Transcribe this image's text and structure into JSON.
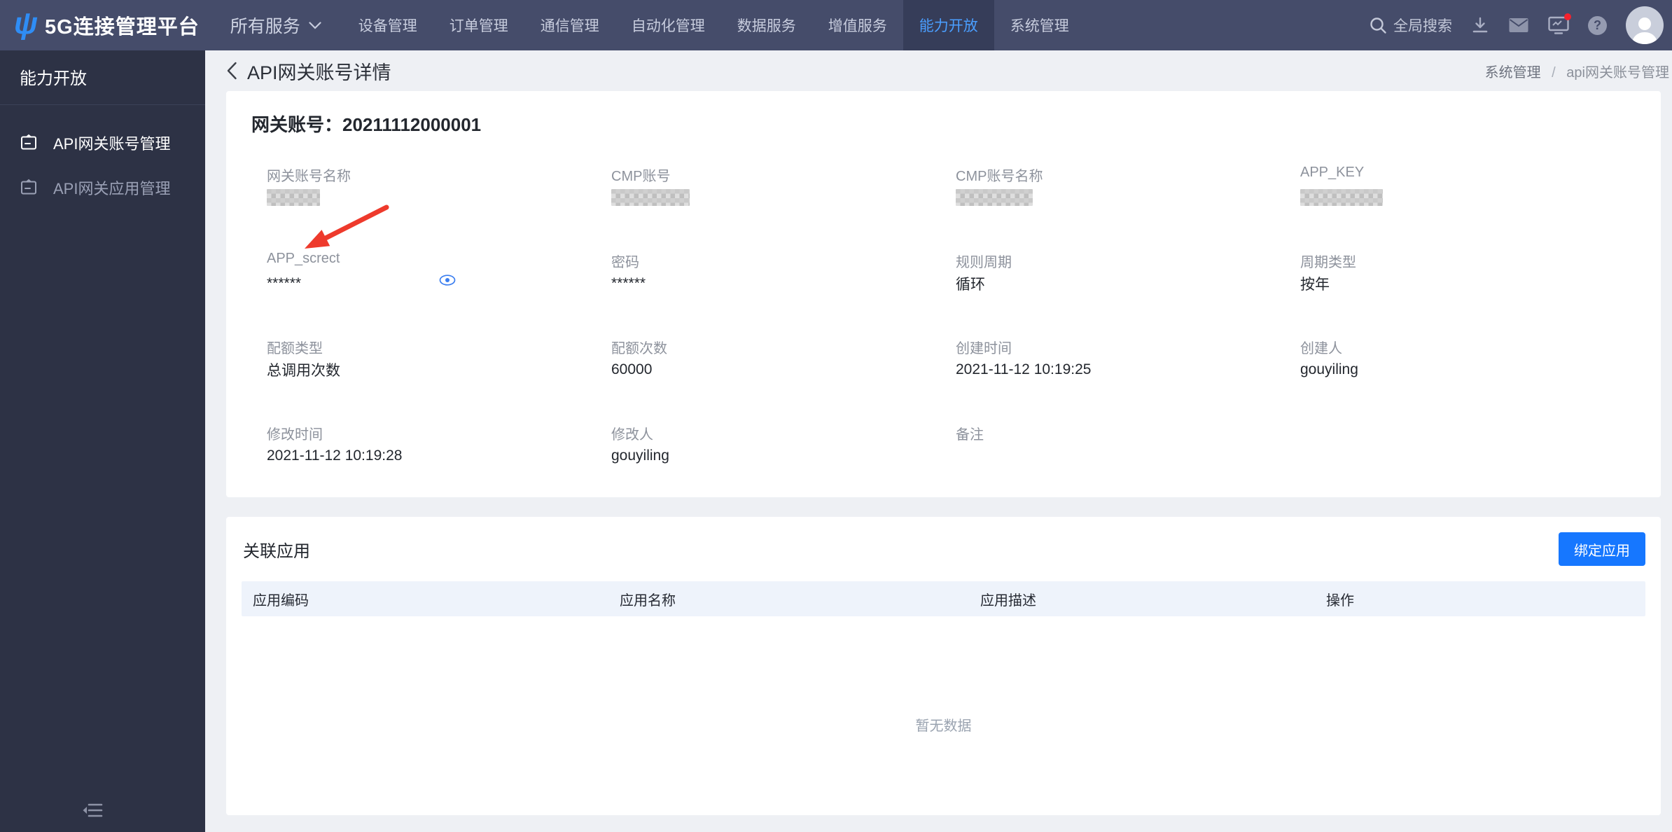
{
  "topbar": {
    "logo_glyph": "ψ",
    "brand": "5G连接管理平台",
    "all_services": "所有服务",
    "nav_items": [
      {
        "label": "设备管理",
        "active": false
      },
      {
        "label": "订单管理",
        "active": false
      },
      {
        "label": "通信管理",
        "active": false
      },
      {
        "label": "自动化管理",
        "active": false
      },
      {
        "label": "数据服务",
        "active": false
      },
      {
        "label": "增值服务",
        "active": false
      },
      {
        "label": "能力开放",
        "active": true
      },
      {
        "label": "系统管理",
        "active": false
      }
    ],
    "search_label": "全局搜索",
    "help_glyph": "?",
    "icons": [
      "search-icon",
      "download-icon",
      "mail-icon",
      "monitor-alert-icon",
      "help-icon",
      "avatar"
    ]
  },
  "sidebar": {
    "title": "能力开放",
    "items": [
      {
        "label": "API网关账号管理",
        "active": true
      },
      {
        "label": "API网关应用管理",
        "active": false
      }
    ]
  },
  "header": {
    "title": "API网关账号详情",
    "breadcrumb_parent": "系统管理",
    "breadcrumb_separator": "/",
    "breadcrumb_current": "api网关账号管理"
  },
  "detail_card": {
    "title": "网关账号：20211112000001",
    "fields": [
      {
        "label": "网关账号名称",
        "value": "",
        "masked": true,
        "mask_w": 76
      },
      {
        "label": "CMP账号",
        "value": "",
        "masked": true,
        "mask_w": 112
      },
      {
        "label": "CMP账号名称",
        "value": "",
        "masked": true,
        "mask_w": 110
      },
      {
        "label": "APP_KEY",
        "value": "",
        "masked": true,
        "mask_w": 118
      },
      {
        "label": "APP_screct",
        "value": "******",
        "has_eye": true
      },
      {
        "label": "密码",
        "value": "******"
      },
      {
        "label": "规则周期",
        "value": "循环"
      },
      {
        "label": "周期类型",
        "value": "按年"
      },
      {
        "label": "配额类型",
        "value": "总调用次数"
      },
      {
        "label": "配额次数",
        "value": "60000"
      },
      {
        "label": "创建时间",
        "value": "2021-11-12 10:19:25"
      },
      {
        "label": "创建人",
        "value": "gouyiling"
      },
      {
        "label": "修改时间",
        "value": "2021-11-12 10:19:28"
      },
      {
        "label": "修改人",
        "value": "gouyiling"
      },
      {
        "label": "备注",
        "value": ""
      }
    ]
  },
  "related_card": {
    "title": "关联应用",
    "bind_button": "绑定应用",
    "table_headers": [
      "应用编码",
      "应用名称",
      "应用描述",
      "操作"
    ],
    "empty_text": "暂无数据"
  },
  "colors": {
    "topbar_bg": "#454c6a",
    "topnav_active_bg": "#363d59",
    "topnav_active_text": "#4a9eff",
    "sidebar_bg": "#2d3245",
    "content_bg": "#eef0f4",
    "accent_blue": "#1677ff",
    "eye_blue": "#3b7ef0",
    "arrow_red": "#ee3a2c",
    "notification_red": "#f5222d"
  }
}
